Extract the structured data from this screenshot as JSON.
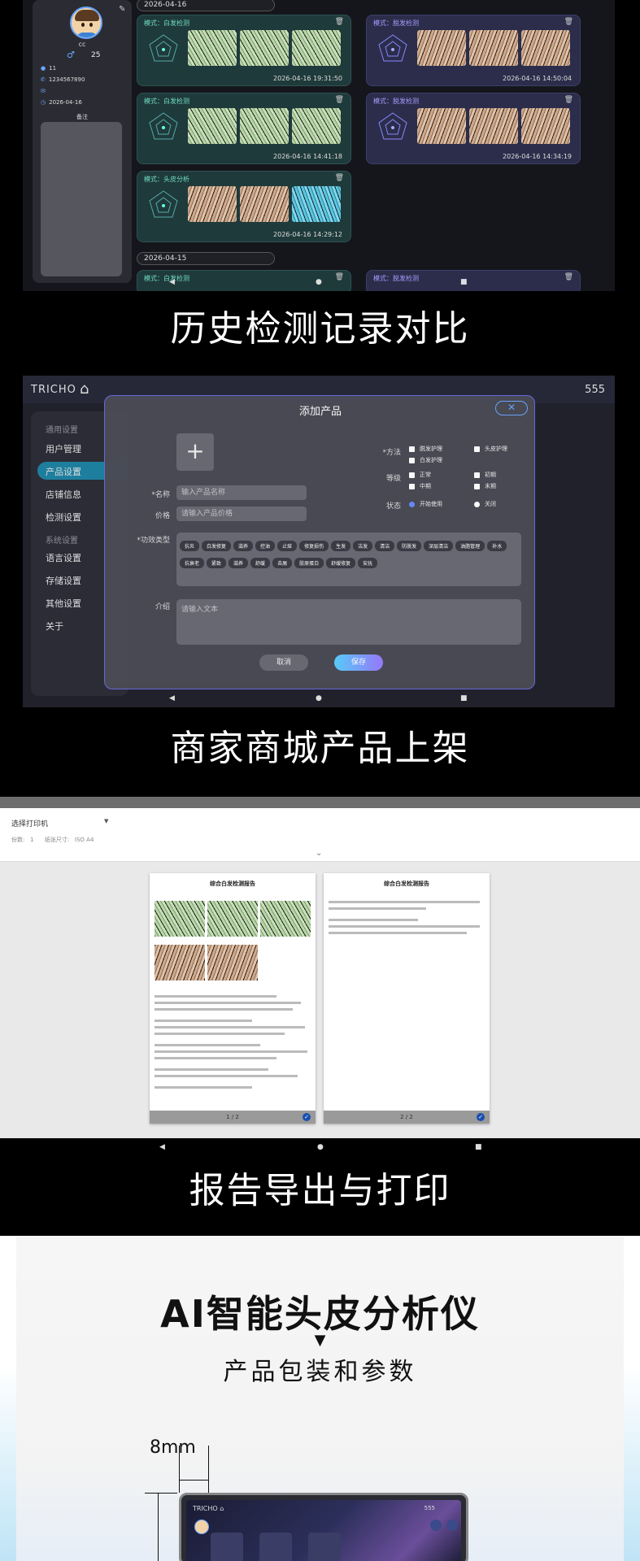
{
  "section1": {
    "sidebar": {
      "name": "cc",
      "gender_symbol": "♂",
      "age": "25",
      "info": [
        "11",
        "1234567890",
        "",
        "2026-04-16"
      ],
      "note_label": "备注"
    },
    "dates": [
      "2026-04-16",
      "2026-04-15"
    ],
    "records": [
      {
        "mode": "模式：白发检测",
        "time": "2026-04-16  19:31:50"
      },
      {
        "mode": "模式：脱发检测",
        "time": "2026-04-16  14:50:04"
      },
      {
        "mode": "模式：白发检测",
        "time": "2026-04-16  14:41:18"
      },
      {
        "mode": "模式：脱发检测",
        "time": "2026-04-16  14:34:19"
      },
      {
        "mode": "模式：头皮分析",
        "time": "2026-04-16  14:29:12"
      },
      {
        "mode": "模式：白发检测",
        "time": ""
      },
      {
        "mode": "模式：脱发检测",
        "time": ""
      }
    ],
    "caption": "历史检测记录对比"
  },
  "section2": {
    "logo": "TRICHO",
    "number": "555",
    "menu": {
      "section_general": "通用设置",
      "items_general": [
        "用户管理",
        "产品设置",
        "店铺信息",
        "检测设置"
      ],
      "section_system": "系统设置",
      "items_system": [
        "语言设置",
        "存储设置",
        "其他设置",
        "关于"
      ]
    },
    "modal": {
      "title": "添加产品",
      "name_label": "*名称",
      "name_placeholder": "输入产品名称",
      "price_label": "价格",
      "price_placeholder": "请输入产品价格",
      "effect_label": "*功效类型",
      "effect_tags": [
        "抗炎",
        "白发修复",
        "滋养",
        "控油",
        "止痒",
        "修复损伤",
        "生发",
        "洁发",
        "清洁",
        "防脱发",
        "深层清洁",
        "油脂管理",
        "补水",
        "抗衰老",
        "紧致",
        "滋养",
        "舒缓",
        "去屑",
        "胶原蛋白",
        "舒缓修复",
        "安抚"
      ],
      "method_label": "*方法",
      "methods": [
        "脱发护理",
        "头皮护理",
        "白发护理"
      ],
      "level_label": "等级",
      "levels": [
        "正常",
        "初期",
        "中期",
        "末期"
      ],
      "status_label": "状态",
      "status_on": "开始使用",
      "status_off": "关闭",
      "intro_label": "介绍",
      "intro_placeholder": "请输入文本",
      "cancel": "取消",
      "save": "保存"
    },
    "caption": "商家商城产品上架"
  },
  "section3": {
    "printer_select": "选择打印机",
    "copies_label": "份数:",
    "copies_value": "1",
    "paper_label": "纸张尺寸:",
    "paper_value": "ISO A4",
    "report_title": "综合白发检测报告",
    "pages": [
      "1 / 2",
      "2 / 2"
    ],
    "caption": "报告导出与打印"
  },
  "section4": {
    "title": "AI智能头皮分析仪",
    "arrow": "▼",
    "subtitle": "产品包装和参数",
    "thickness": "8mm",
    "tablet_logo": "TRICHO",
    "tablet_number": "555"
  }
}
